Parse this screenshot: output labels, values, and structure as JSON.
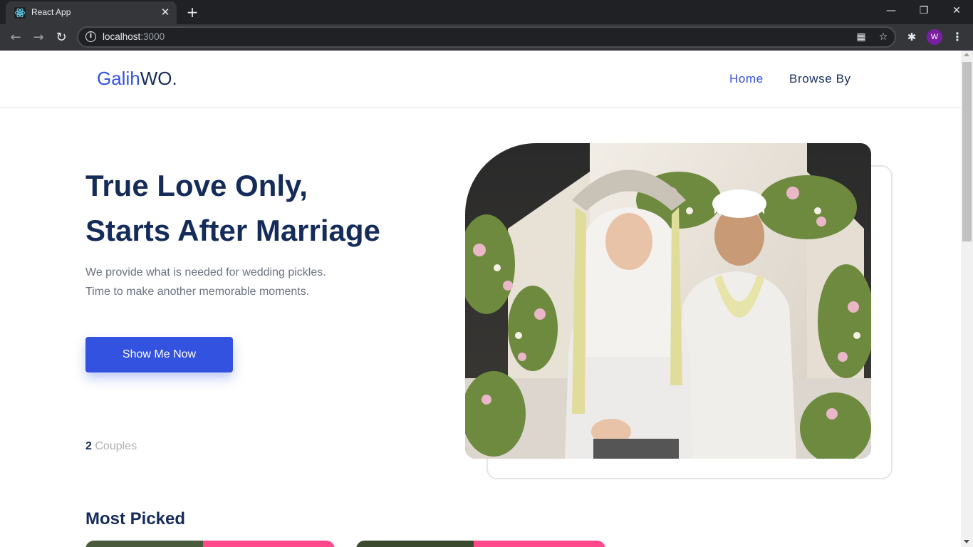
{
  "browser": {
    "tab_title": "React App",
    "tab_close_glyph": "✕",
    "new_tab_glyph": "+",
    "url_host": "localhost",
    "url_port": ":3000",
    "profile_initial": "W",
    "icons": [
      "react-favicon-icon",
      "back-icon",
      "forward-icon",
      "reload-icon",
      "site-info-icon",
      "qr-code-icon",
      "star-icon",
      "extensions-icon",
      "menu-icon"
    ]
  },
  "site": {
    "brand_part1": "Galih",
    "brand_part2": "WO.",
    "nav": {
      "home": "Home",
      "browse": "Browse By"
    },
    "hero": {
      "title_line1": "True Love Only,",
      "title_line2": "Starts After Marriage",
      "description": "We provide what is needed for wedding pickles. Time to make another memorable moments.",
      "cta_label": "Show Me Now",
      "stat_value": "2",
      "stat_label": "Couples"
    },
    "section_title": "Most Picked"
  },
  "colors": {
    "primary": "#3252df",
    "navy": "#152c5b",
    "muted": "#b0b0b0",
    "badge": "#ff498b"
  }
}
